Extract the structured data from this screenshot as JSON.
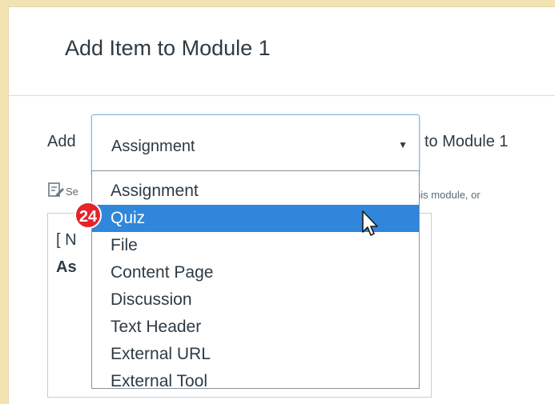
{
  "dialog": {
    "title": "Add Item to Module 1"
  },
  "add_row": {
    "add_label": "Add",
    "selected_type": "Assignment",
    "to_module_label": "to Module 1"
  },
  "hint": {
    "text_left": "Se",
    "text_right": "th this module, or"
  },
  "preview_list": {
    "line1": "[ N",
    "line2": "As"
  },
  "dropdown": {
    "options": [
      "Assignment",
      "Quiz",
      "File",
      "Content Page",
      "Discussion",
      "Text Header",
      "External URL",
      "External Tool"
    ],
    "selected_index": 1
  },
  "step_badge": "24",
  "colors": {
    "selected_bg": "#2f86da",
    "badge": "#e3242b",
    "frame": "#f3e3b3"
  },
  "icons": {
    "hint": "edit-document-icon",
    "cursor": "mouse-pointer-icon",
    "caret": "dropdown-caret-icon"
  }
}
